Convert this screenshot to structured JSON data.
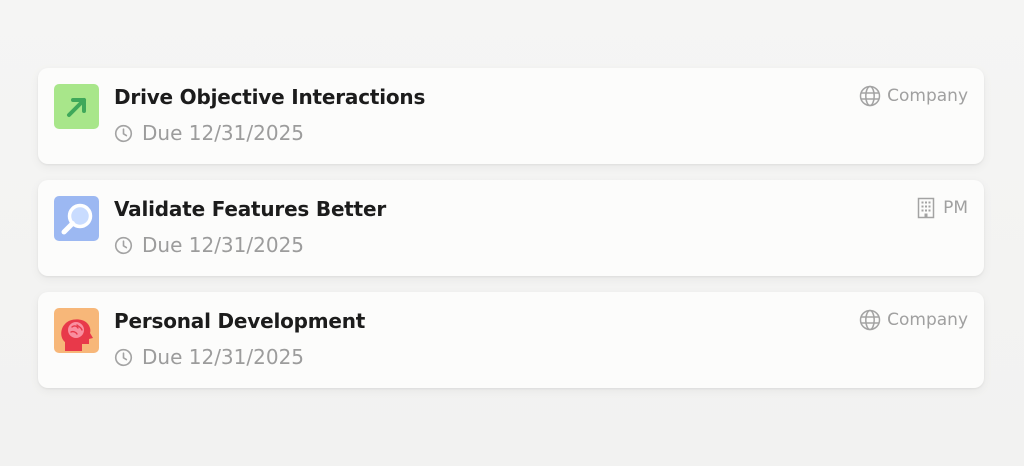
{
  "goals": [
    {
      "title": "Drive Objective Interactions",
      "due": "Due 12/31/2025",
      "scope": "Company",
      "icon": "arrow-up-right-icon",
      "icon_bg": "#a8e68a",
      "scope_icon": "globe-icon"
    },
    {
      "title": "Validate Features Better",
      "due": "Due 12/31/2025",
      "scope": "PM",
      "icon": "magnifier-icon",
      "icon_bg": "#9cb8f2",
      "scope_icon": "building-icon"
    },
    {
      "title": "Personal Development",
      "due": "Due 12/31/2025",
      "scope": "Company",
      "icon": "head-brain-icon",
      "icon_bg": "#f7b779",
      "scope_icon": "globe-icon"
    }
  ]
}
